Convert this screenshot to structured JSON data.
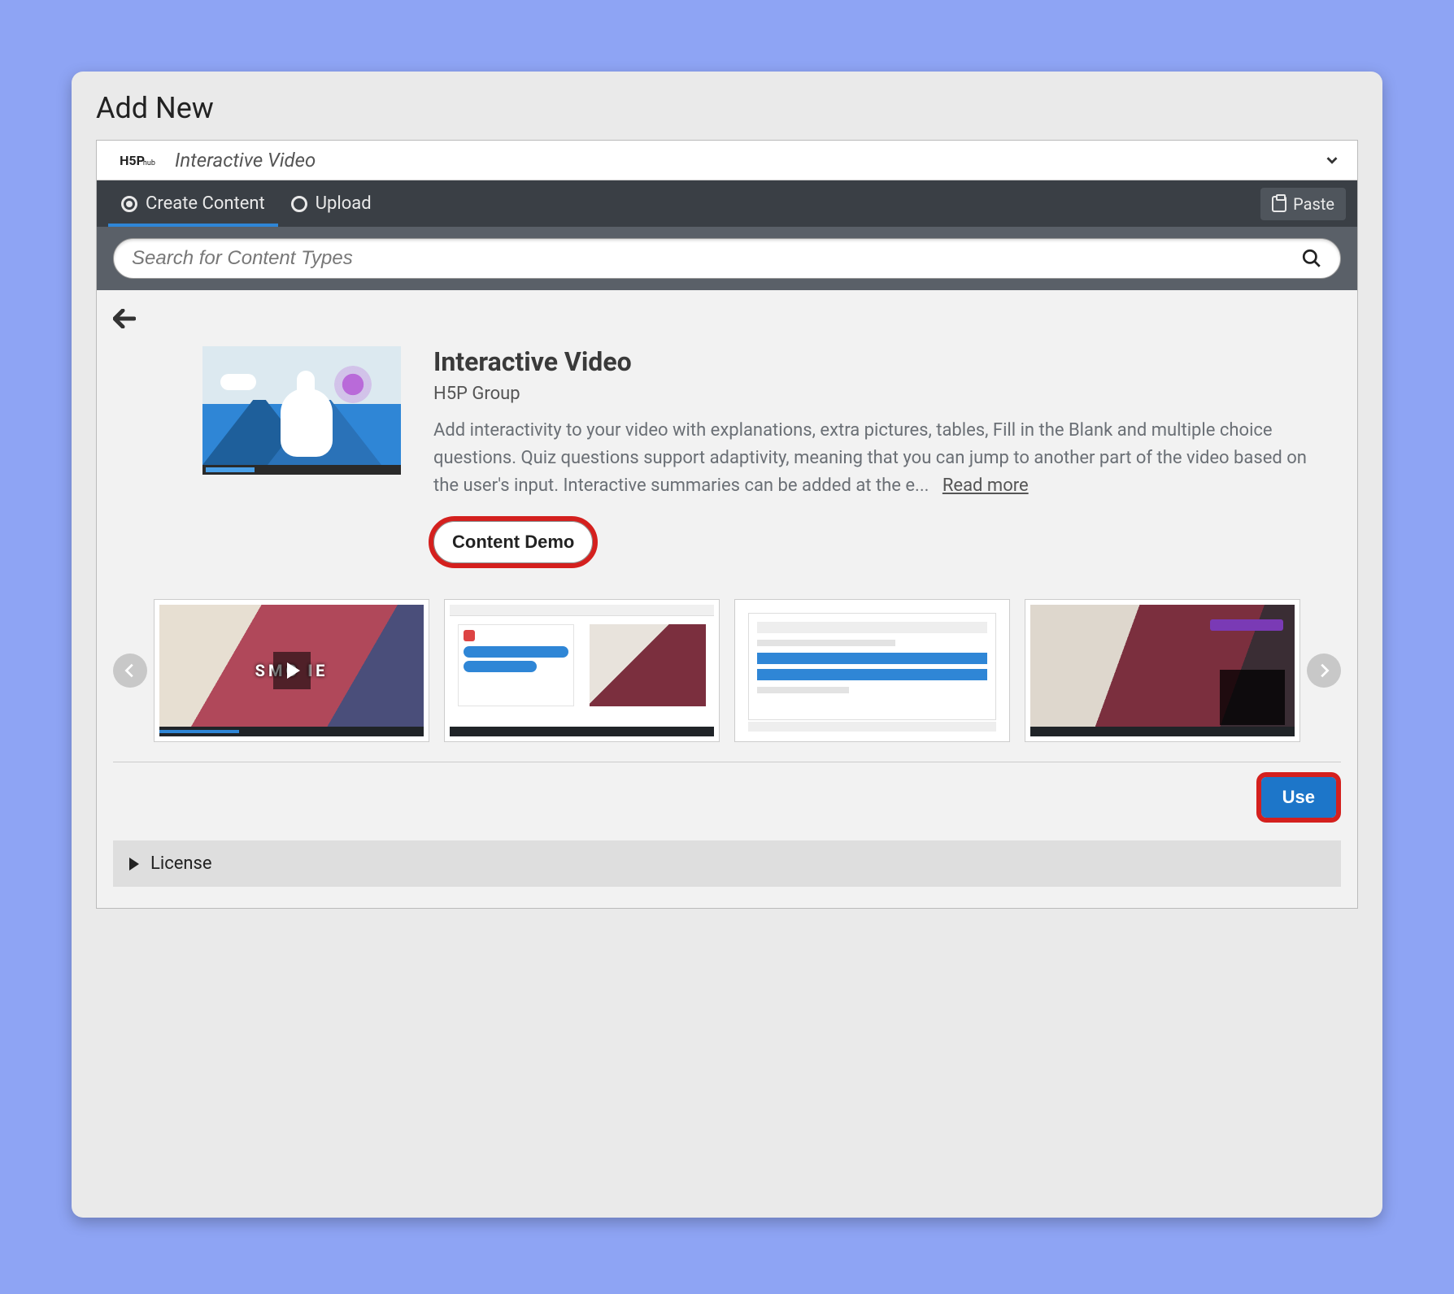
{
  "page": {
    "title": "Add New"
  },
  "hub": {
    "logo_main": "H5P",
    "logo_sub": "hub",
    "selected_type": "Interactive Video"
  },
  "tabs": {
    "create": "Create Content",
    "upload": "Upload"
  },
  "paste": {
    "label": "Paste"
  },
  "search": {
    "placeholder": "Search for Content Types"
  },
  "detail": {
    "title": "Interactive Video",
    "author": "H5P Group",
    "description": "Add interactivity to your video with explanations, extra pictures, tables, Fill in the Blank and multiple choice questions. Quiz questions support adaptivity, meaning that you can jump to another part of the video based on the user's input. Interactive summaries can be added at the e...",
    "read_more": "Read more",
    "demo_button": "Content Demo",
    "use_button": "Use"
  },
  "slides": {
    "s1_text": "SMO   IE"
  },
  "license": {
    "label": "License"
  }
}
